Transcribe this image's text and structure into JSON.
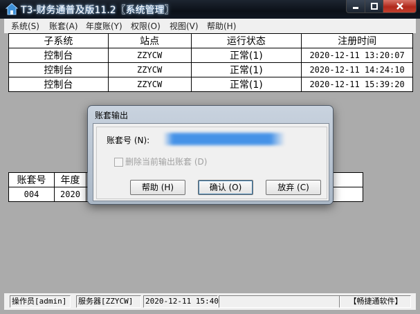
{
  "window": {
    "title": "T3-财务通普及版11.2〖系统管理〗",
    "accent": "#0b1018",
    "close_color": "#c2412f"
  },
  "menu": [
    {
      "label": "系统(S)"
    },
    {
      "label": "账套(A)"
    },
    {
      "label": "年度账(Y)"
    },
    {
      "label": "权限(O)"
    },
    {
      "label": "视图(V)"
    },
    {
      "label": "帮助(H)"
    }
  ],
  "sessions": {
    "headers": [
      "子系统",
      "站点",
      "运行状态",
      "注册时间"
    ],
    "rows": [
      [
        "控制台",
        "ZZYCW",
        "正常(1)",
        "2020-12-11 13:20:07"
      ],
      [
        "控制台",
        "ZZYCW",
        "正常(1)",
        "2020-12-11 14:24:10"
      ],
      [
        "控制台",
        "ZZYCW",
        "正常(1)",
        "2020-12-11 15:39:20"
      ]
    ]
  },
  "accounts": {
    "headers": [
      "账套号",
      "年度"
    ],
    "rows": [
      [
        "004",
        "2020"
      ]
    ]
  },
  "dialog": {
    "title": "账套输出",
    "account_label": "账套号 (N):",
    "delete_checkbox": "删除当前输出账套 (D)",
    "delete_checked": false,
    "help_button": "帮助 (H)",
    "ok_button": "确认 (O)",
    "cancel_button": "放弃 (C)"
  },
  "status": {
    "operator": "操作员[admin]",
    "server": "服务器[ZZYCW]",
    "datetime": "2020-12-11 15:40",
    "vendor": "【畅捷通软件】"
  }
}
